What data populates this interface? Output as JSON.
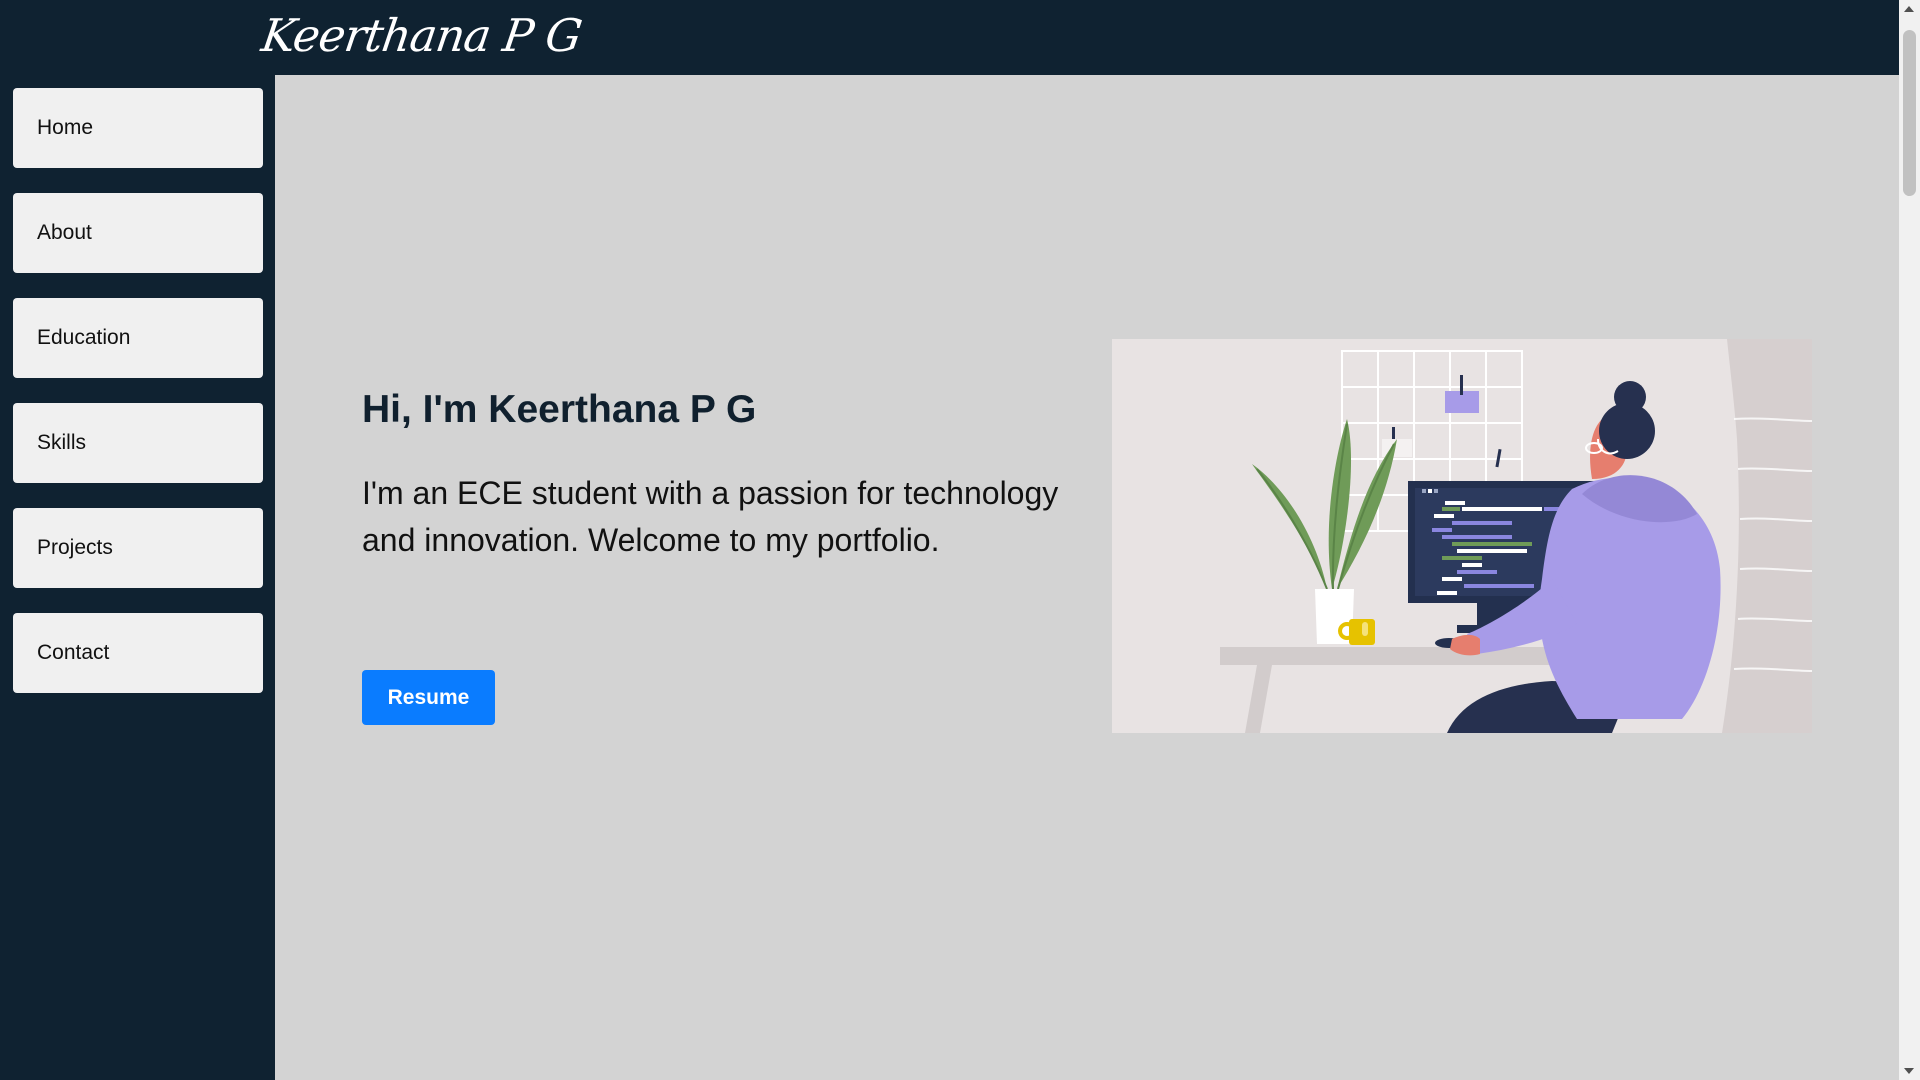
{
  "header": {
    "logo_text": "Keerthana P G"
  },
  "sidebar": {
    "items": [
      {
        "label": "Home"
      },
      {
        "label": "About"
      },
      {
        "label": "Education"
      },
      {
        "label": "Skills"
      },
      {
        "label": "Projects"
      },
      {
        "label": "Contact"
      }
    ]
  },
  "hero": {
    "title": "Hi, I'm Keerthana P G",
    "text": "I'm an ECE student with a passion for technology and innovation. Welcome to my portfolio.",
    "button_label": "Resume",
    "illustration_icon": "developer-at-desk-illustration"
  },
  "colors": {
    "navy": "#0f2231",
    "content_bg": "#d3d3d3",
    "nav_item_bg": "#f0f0f0",
    "button_blue": "#0a7cff",
    "title_color": "#10202e"
  }
}
